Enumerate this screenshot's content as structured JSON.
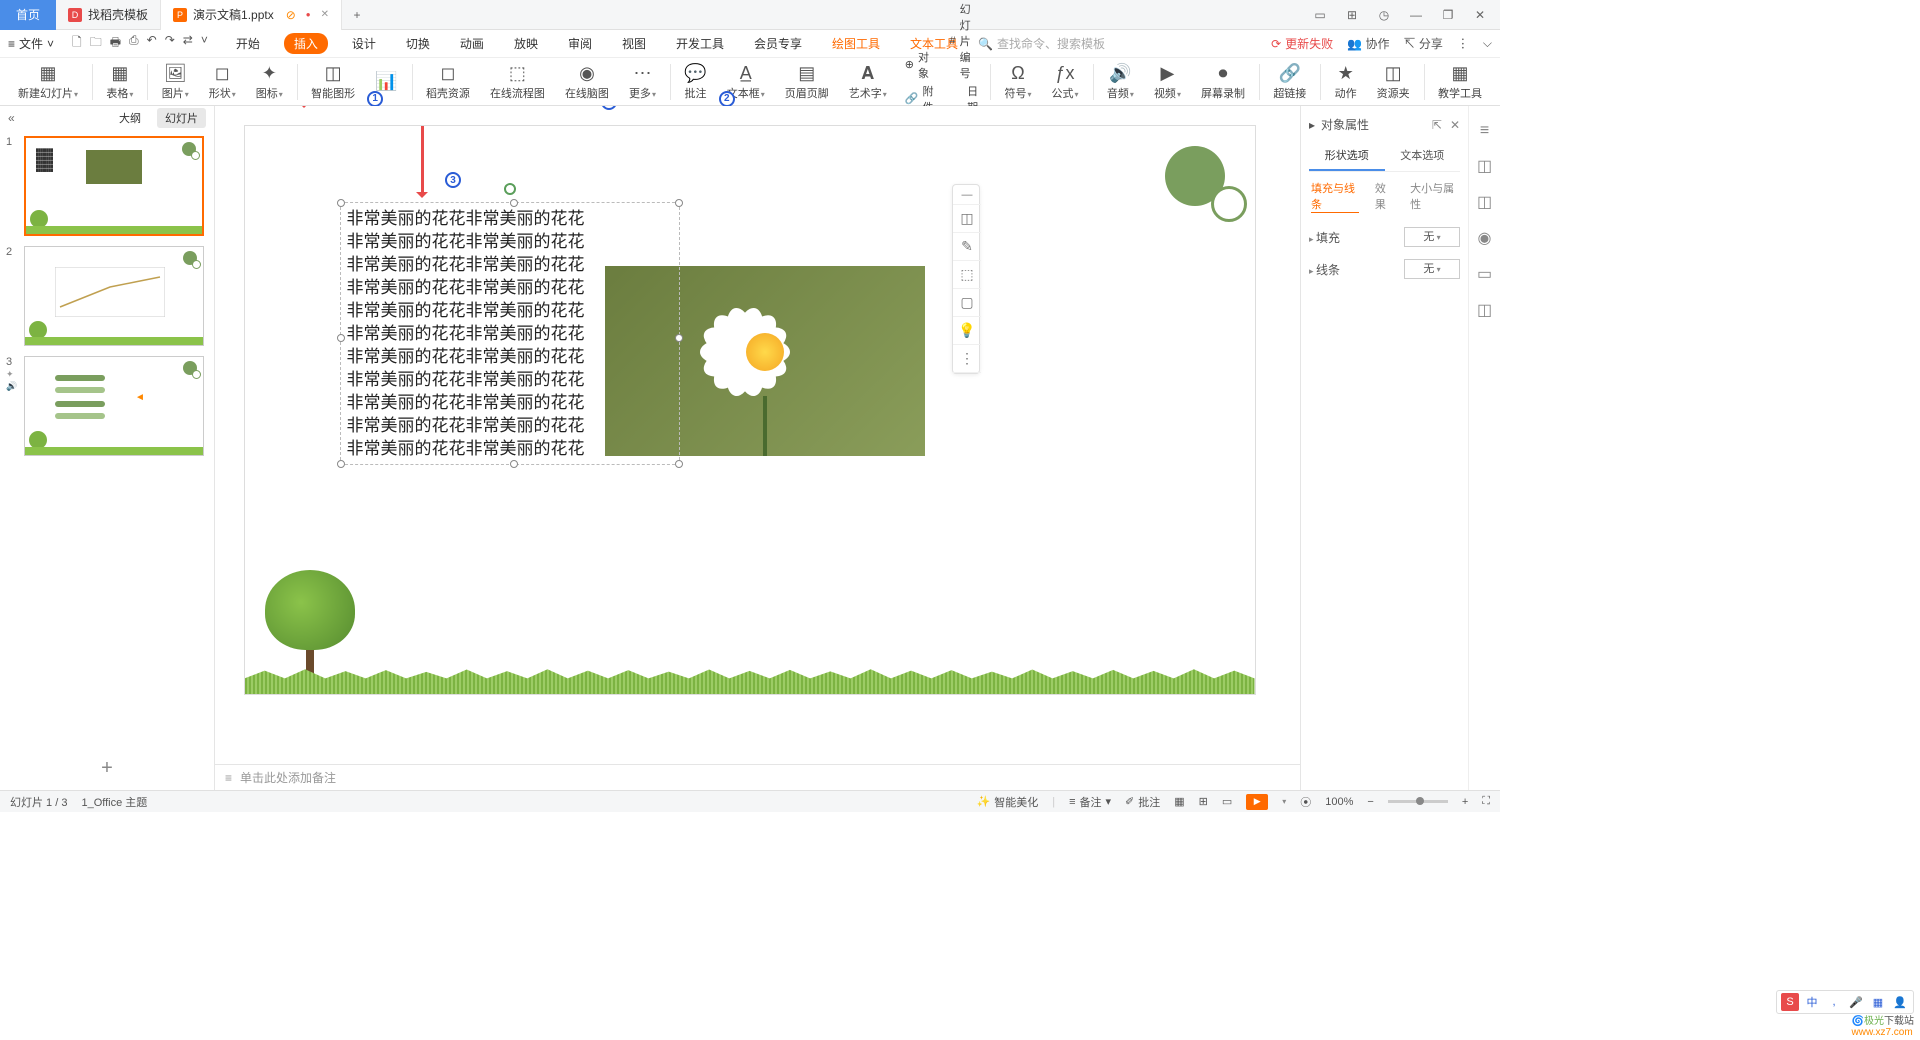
{
  "titlebar": {
    "home": "首页",
    "tabs": [
      {
        "icon_color": "#e84a4a",
        "label": "找稻壳模板"
      },
      {
        "icon_color": "#ff6a00",
        "label": "演示文稿1.pptx",
        "active": true,
        "warn": "⊘",
        "dot": "●"
      }
    ],
    "win_icons": [
      "▭",
      "⊞",
      "◷",
      "—",
      "❐",
      "✕"
    ]
  },
  "menubar": {
    "file_icon": "≡",
    "file": "文件",
    "file_drop": "˅",
    "qat": [
      "🗋",
      "🗀",
      "🖶",
      "⎙",
      "↶",
      "↷",
      "⇄",
      "˅"
    ],
    "tabs": [
      "开始",
      "插入",
      "设计",
      "切换",
      "动画",
      "放映",
      "审阅",
      "视图",
      "开发工具",
      "会员专享"
    ],
    "active_idx": 1,
    "extra": [
      {
        "t": "绘图工具",
        "c": "orange"
      },
      {
        "t": "文本工具",
        "c": "orange"
      }
    ],
    "search_icon": "🔍",
    "search_ph": "查找命令、搜索模板",
    "right": {
      "warn_icon": "⟳",
      "warn": "更新失败",
      "coop_icon": "👥",
      "coop": "协作",
      "share_icon": "↸",
      "share": "分享",
      "more": "︙",
      "drop": "⌵"
    }
  },
  "ribbon": [
    {
      "i": "▦",
      "l": "新建幻灯片",
      "d": true
    },
    {
      "sep": true
    },
    {
      "i": "▦",
      "l": "表格",
      "d": true
    },
    {
      "sep": true
    },
    {
      "i": "🖼",
      "l": "图片",
      "d": true
    },
    {
      "i": "◻",
      "l": "形状",
      "d": true
    },
    {
      "i": "✦",
      "l": "图标",
      "d": true
    },
    {
      "sep": true
    },
    {
      "i": "◫",
      "l": "智能图形"
    },
    {
      "i": "📊",
      "l": "",
      "anno": 1
    },
    {
      "sep": true
    },
    {
      "i": "◻",
      "l": "稻壳资源"
    },
    {
      "i": "⬚",
      "l": "在线流程图"
    },
    {
      "i": "◉",
      "l": "在线脑图"
    },
    {
      "i": "⋯",
      "l": "更多",
      "d": true
    },
    {
      "sep": true
    },
    {
      "i": "💬",
      "l": "批注"
    },
    {
      "i": "A̲",
      "l": "文本框",
      "d": true,
      "anno": 2
    },
    {
      "i": "▤",
      "l": "页眉页脚"
    },
    {
      "i": "𝐀",
      "l": "艺术字",
      "d": true
    },
    {
      "line": [
        {
          "i": "⊕",
          "t": "对象"
        },
        {
          "i": "🔗",
          "t": "附件"
        }
      ]
    },
    {
      "line": [
        {
          "i": "#",
          "t": "幻灯片编号"
        },
        {
          "i": "📅",
          "t": "日期和时间"
        }
      ]
    },
    {
      "sep": true
    },
    {
      "i": "Ω",
      "l": "符号",
      "d": true
    },
    {
      "i": "ƒx",
      "l": "公式",
      "d": true
    },
    {
      "sep": true
    },
    {
      "i": "🔊",
      "l": "音频",
      "d": true
    },
    {
      "i": "▶",
      "l": "视频",
      "d": true
    },
    {
      "i": "⏺",
      "l": "屏幕录制"
    },
    {
      "sep": true
    },
    {
      "i": "🔗",
      "l": "超链接"
    },
    {
      "sep": true
    },
    {
      "i": "★",
      "l": "动作"
    },
    {
      "i": "◫",
      "l": "资源夹"
    },
    {
      "sep": true
    },
    {
      "i": "▦",
      "l": "教学工具"
    }
  ],
  "side": {
    "collapse": "«",
    "tabs": [
      {
        "l": "大纲"
      },
      {
        "l": "幻灯片",
        "active": true
      }
    ],
    "thumbs": [
      1,
      2,
      3
    ],
    "icons3": [
      "✦",
      "🔊"
    ]
  },
  "slide_text_line": "非常美丽的花花非常美丽的花花",
  "slide_text_lines": 11,
  "float_toolbar": [
    "—",
    "◫",
    "✎",
    "⬚",
    "▢",
    "💡",
    "⋮"
  ],
  "annotations": {
    "a3": 3
  },
  "canvas_scroll": {
    "v": "║",
    "h": "═"
  },
  "right": {
    "title_icon": "▸",
    "title": "对象属性",
    "pin": "⇱",
    "close": "✕",
    "tabs": [
      {
        "l": "形状选项",
        "active": true
      },
      {
        "l": "文本选项"
      }
    ],
    "subtabs": [
      {
        "l": "填充与线条",
        "active": true
      },
      {
        "l": "效果"
      },
      {
        "l": "大小与属性"
      }
    ],
    "rows": [
      {
        "l": "填充",
        "v": "无"
      },
      {
        "l": "线条",
        "v": "无"
      }
    ],
    "rail": [
      "≡",
      "◫",
      "◫",
      "◉",
      "▭",
      "◫"
    ]
  },
  "notes": {
    "icon": "≡",
    "ph": "单击此处添加备注"
  },
  "status": {
    "slide": "幻灯片 1 / 3",
    "theme": "1_Office 主题",
    "right": [
      {
        "i": "✨",
        "t": "智能美化"
      },
      {
        "i": "≡",
        "t": "备注",
        "d": true
      },
      {
        "i": "✐",
        "t": "批注"
      },
      {
        "i": "▦"
      },
      {
        "i": "⊞"
      },
      {
        "i": "▭"
      },
      {
        "play": true,
        "d": true
      },
      {
        "i": "⦿"
      },
      {
        "t": "100%"
      },
      {
        "i": "−"
      },
      {
        "slider": true
      },
      {
        "i": "+"
      },
      {
        "i": "⛶"
      }
    ]
  },
  "ime": [
    "S",
    "中",
    ",",
    "🎤",
    "▦",
    "👤"
  ],
  "watermark": {
    "a": "极光",
    "b": "下载站",
    "c": "www.xz7.com"
  }
}
